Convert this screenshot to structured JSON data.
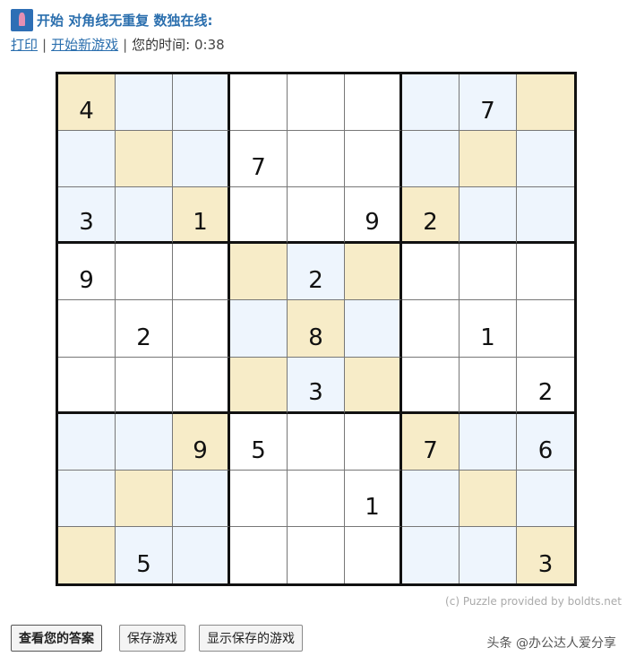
{
  "header": {
    "title": "开始 对角线无重复 数独在线:",
    "print_link": "打印",
    "new_game_link": "开始新游戏",
    "separator": "|",
    "timer_label": "您的时间:",
    "timer_value": "0:38"
  },
  "board": {
    "cells": [
      [
        "4",
        "",
        "",
        "",
        "",
        "",
        "",
        "7",
        ""
      ],
      [
        "",
        "",
        "",
        "7",
        "",
        "",
        "",
        "",
        ""
      ],
      [
        "3",
        "",
        "1",
        "",
        "",
        "9",
        "2",
        "",
        ""
      ],
      [
        "9",
        "",
        "",
        "",
        "2",
        "",
        "",
        "",
        ""
      ],
      [
        "",
        "2",
        "",
        "",
        "8",
        "",
        "",
        "1",
        ""
      ],
      [
        "",
        "",
        "",
        "",
        "3",
        "",
        "",
        "",
        "2"
      ],
      [
        "",
        "",
        "9",
        "5",
        "",
        "",
        "7",
        "",
        "6"
      ],
      [
        "",
        "",
        "",
        "",
        "",
        "1",
        "",
        "",
        ""
      ],
      [
        "",
        "5",
        "",
        "",
        "",
        "",
        "",
        "",
        "3"
      ]
    ],
    "shading": [
      [
        "gold",
        "blue",
        "blue",
        "white",
        "white",
        "white",
        "blue",
        "blue",
        "gold"
      ],
      [
        "blue",
        "gold",
        "blue",
        "white",
        "white",
        "white",
        "blue",
        "gold",
        "blue"
      ],
      [
        "blue",
        "blue",
        "gold",
        "white",
        "white",
        "white",
        "gold",
        "blue",
        "blue"
      ],
      [
        "white",
        "white",
        "white",
        "gold",
        "blue",
        "gold",
        "white",
        "white",
        "white"
      ],
      [
        "white",
        "white",
        "white",
        "blue",
        "gold",
        "blue",
        "white",
        "white",
        "white"
      ],
      [
        "white",
        "white",
        "white",
        "gold",
        "blue",
        "gold",
        "white",
        "white",
        "white"
      ],
      [
        "blue",
        "blue",
        "gold",
        "white",
        "white",
        "white",
        "gold",
        "blue",
        "blue"
      ],
      [
        "blue",
        "gold",
        "blue",
        "white",
        "white",
        "white",
        "blue",
        "gold",
        "blue"
      ],
      [
        "gold",
        "blue",
        "blue",
        "white",
        "white",
        "white",
        "blue",
        "blue",
        "gold"
      ]
    ]
  },
  "footer": {
    "credit": "(c) Puzzle provided by boldts.net",
    "check_button": "查看您的答案",
    "save_button": "保存游戏",
    "show_saved_button": "显示保存的游戏",
    "watermark": "头条 @办公达人爱分享"
  },
  "colors": {
    "accent": "#2b6fae",
    "gold_cell": "#f7ecc8",
    "blue_cell": "#eef5fd"
  }
}
